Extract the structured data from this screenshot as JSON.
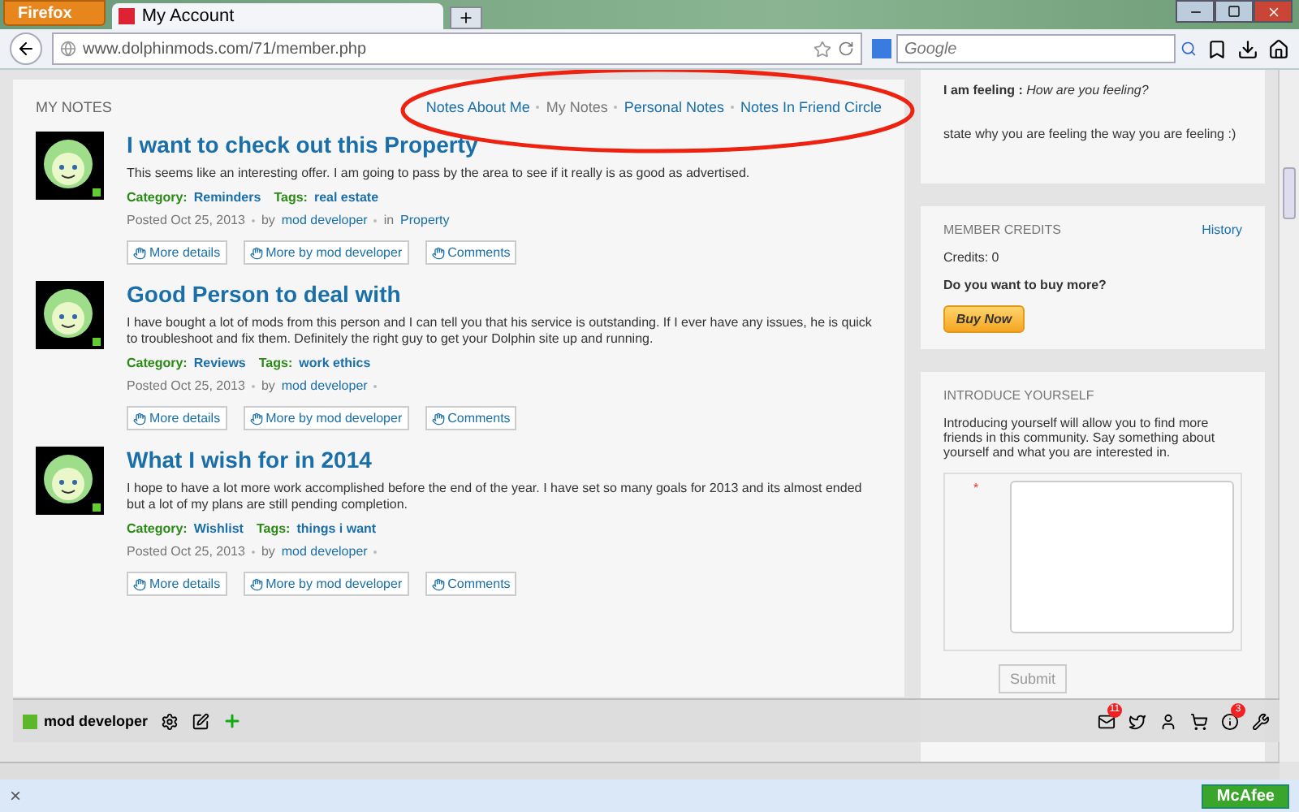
{
  "browser": {
    "menu_button": "Firefox",
    "tab_title": "My Account",
    "url": "www.dolphinmods.com/71/member.php",
    "search_placeholder": "Google"
  },
  "notes": {
    "title": "MY NOTES",
    "filters": [
      {
        "label": "Notes About Me",
        "selected": false
      },
      {
        "label": "My Notes",
        "selected": true
      },
      {
        "label": "Personal Notes",
        "selected": false
      },
      {
        "label": "Notes In Friend Circle",
        "selected": false
      }
    ],
    "items": [
      {
        "title": "I want to check out this Property",
        "body": "This seems like an interesting offer. I am going to pass by the area to see if it really is as good as advertised.",
        "category_label": "Category:",
        "category": "Reminders",
        "tags_label": "Tags:",
        "tags": "real estate",
        "posted": "Posted Oct 25, 2013",
        "by": "by",
        "author": "mod developer",
        "in": "in",
        "place": "Property",
        "actions": [
          "More details",
          "More by mod developer",
          "Comments"
        ]
      },
      {
        "title": "Good Person to deal with",
        "body": "I have bought a lot of mods from this person and I can tell you that his service is outstanding. If I ever have any issues, he is quick to troubleshoot and fix them. Definitely the right guy to get your Dolphin site up and running.",
        "category_label": "Category:",
        "category": "Reviews",
        "tags_label": "Tags:",
        "tags": "work ethics",
        "posted": "Posted Oct 25, 2013",
        "by": "by",
        "author": "mod developer",
        "actions": [
          "More details",
          "More by mod developer",
          "Comments"
        ]
      },
      {
        "title": "What I wish for in 2014",
        "body": "I hope to have a lot more work accomplished before the end of the year. I have set so many goals for 2013 and its almost ended but a lot of my plans are still pending completion.",
        "category_label": "Category:",
        "category": "Wishlist",
        "tags_label": "Tags:",
        "tags": "things i want",
        "posted": "Posted Oct 25, 2013",
        "by": "by",
        "author": "mod developer",
        "actions": [
          "More details",
          "More by mod developer",
          "Comments"
        ]
      }
    ]
  },
  "feeling": {
    "label": "I am feeling :",
    "value": "How are you feeling?",
    "reason": "state why you are feeling the way you are feeling :)"
  },
  "credits": {
    "title": "MEMBER CREDITS",
    "link": "History",
    "credits": "Credits: 0",
    "question": "Do you want to buy more?",
    "button": "Buy Now"
  },
  "introduce": {
    "title": "INTRODUCE YOURSELF",
    "text": "Introducing yourself will allow you to find more friends in this community. Say something about yourself and what you are interested in.",
    "required_mark": "*",
    "submit": "Submit"
  },
  "toolbar": {
    "user": "mod developer",
    "mail_count": "11",
    "info_count": "3"
  },
  "status_bar": {
    "close": "×",
    "addon": "McAfee"
  }
}
